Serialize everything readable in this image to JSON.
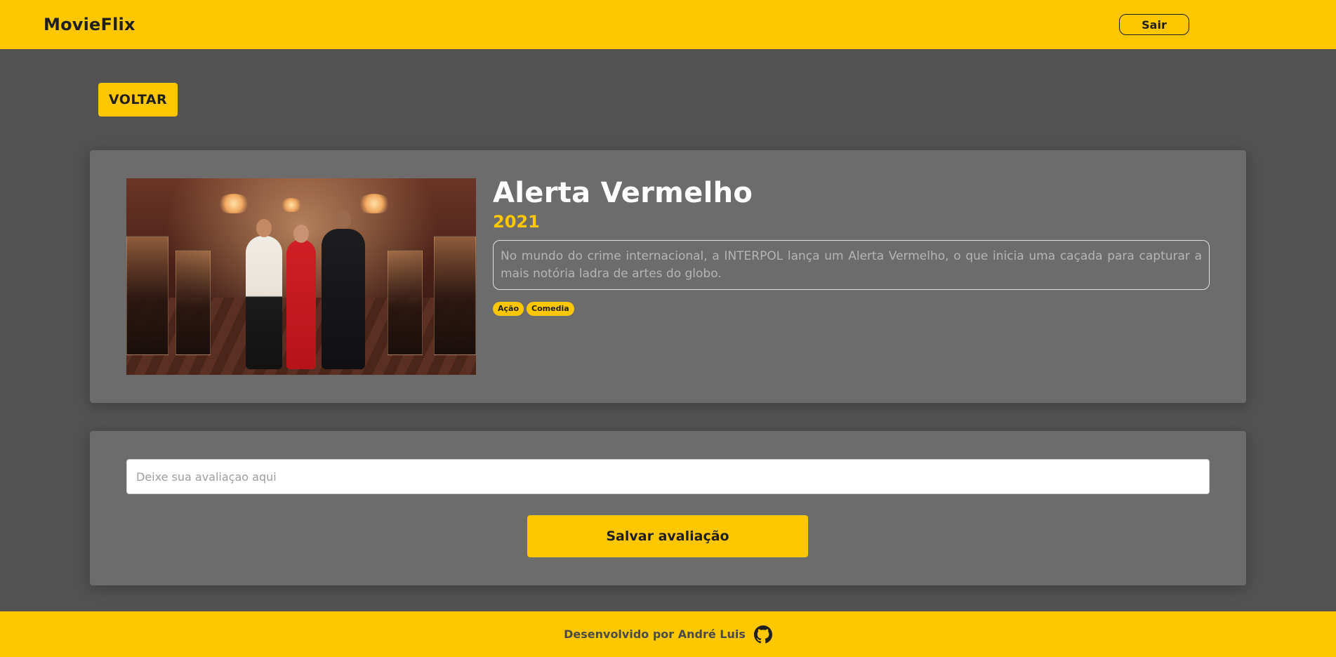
{
  "header": {
    "brand": "MovieFlix",
    "logout_label": "Sair"
  },
  "back_button": {
    "label": "VOLTAR"
  },
  "movie": {
    "title": "Alerta Vermelho",
    "year": "2021",
    "synopsis": "No mundo do crime internacional, a INTERPOL lança um Alerta Vermelho, o que inicia uma caçada para capturar a mais notória ladra de artes do globo.",
    "genres": [
      "Ação",
      "Comedia"
    ]
  },
  "review": {
    "placeholder": "Deixe sua avaliaçao aqui",
    "value": "",
    "save_label": "Salvar avaliação"
  },
  "footer": {
    "text": "Desenvolvido por André Luis",
    "icon": "github-icon"
  },
  "colors": {
    "accent": "#FFC700",
    "background": "#525252",
    "card": "#6C6C6C"
  }
}
